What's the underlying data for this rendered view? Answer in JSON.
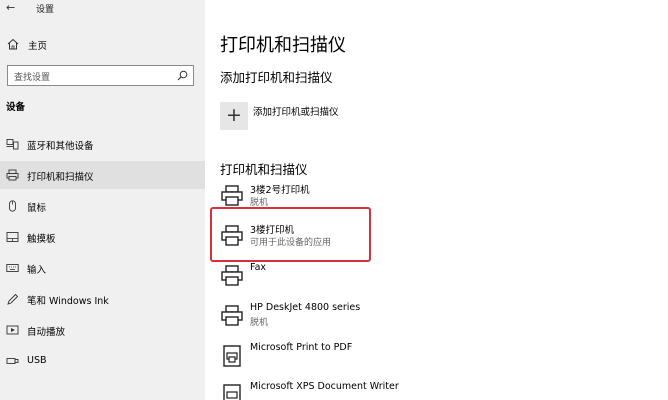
{
  "window": {
    "title": "设置"
  },
  "sidebar": {
    "home_label": "主页",
    "search_placeholder": "查找设置",
    "section_title": "设备",
    "items": [
      {
        "label": "蓝牙和其他设备",
        "icon": "bluetooth-devices-icon",
        "selected": false
      },
      {
        "label": "打印机和扫描仪",
        "icon": "printer-icon",
        "selected": true
      },
      {
        "label": "鼠标",
        "icon": "mouse-icon",
        "selected": false
      },
      {
        "label": "触摸板",
        "icon": "touchpad-icon",
        "selected": false
      },
      {
        "label": "输入",
        "icon": "keyboard-icon",
        "selected": false
      },
      {
        "label": "笔和 Windows Ink",
        "icon": "pen-icon",
        "selected": false
      },
      {
        "label": "自动播放",
        "icon": "autoplay-icon",
        "selected": false
      },
      {
        "label": "USB",
        "icon": "usb-icon",
        "selected": false
      }
    ]
  },
  "main": {
    "title": "打印机和扫描仪",
    "add_heading": "添加打印机和扫描仪",
    "add_label": "添加打印机或扫描仪",
    "list_heading": "打印机和扫描仪",
    "printers": [
      {
        "name": "3楼2号打印机",
        "status": "脱机",
        "icon": "printer-icon"
      },
      {
        "name": "3楼打印机",
        "status": "可用于此设备的应用",
        "icon": "printer-icon",
        "highlighted": true
      },
      {
        "name": "Fax",
        "status": "",
        "icon": "fax-icon"
      },
      {
        "name": "HP DeskJet 4800 series",
        "status": "脱机",
        "icon": "printer-icon"
      },
      {
        "name": "Microsoft Print to PDF",
        "status": "",
        "icon": "pdf-printer-icon"
      },
      {
        "name": "Microsoft XPS Document Writer",
        "status": "",
        "icon": "xps-printer-icon"
      }
    ]
  },
  "colors": {
    "highlight": "#d6323a",
    "sidebar_bg": "#f0f0f0",
    "selected_bg": "#e0e0e0"
  }
}
